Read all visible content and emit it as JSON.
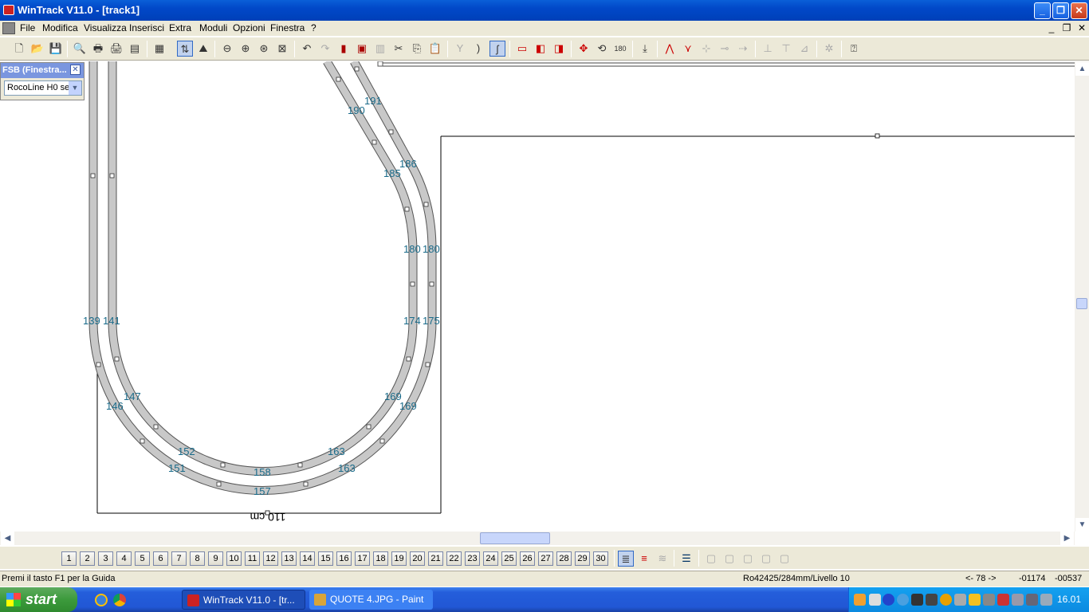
{
  "window": {
    "title": "WinTrack  V11.0 - [track1]"
  },
  "menu": [
    "File",
    "Modifica",
    "Visualizza",
    "Inserisci",
    "Extra",
    "Moduli",
    "Opzioni",
    "Finestra",
    "?"
  ],
  "fsb": {
    "title": "FSB (Finestra...",
    "selected": "RocoLine H0 se"
  },
  "track_labels": [
    "191",
    "190",
    "186",
    "185",
    "180",
    "180",
    "139",
    "141",
    "174",
    "175",
    "147",
    "146",
    "169",
    "169",
    "152",
    "151",
    "163",
    "163",
    "158",
    "157"
  ],
  "dimension_label": "110 cm",
  "layers": [
    "1",
    "2",
    "3",
    "4",
    "5",
    "6",
    "7",
    "8",
    "9",
    "10",
    "11",
    "12",
    "13",
    "14",
    "15",
    "16",
    "17",
    "18",
    "19",
    "20",
    "21",
    "22",
    "23",
    "24",
    "25",
    "26",
    "27",
    "28",
    "29",
    "30"
  ],
  "status": {
    "help": "Premi il tasto F1 per la Guida",
    "info": "Ro42425/284mm/Livello 10",
    "nav": "<- 78 ->",
    "x": "-01174",
    "y": "-00537"
  },
  "taskbar": {
    "start": "start",
    "tasks": [
      "WinTrack  V11.0 - [tr...",
      "QUOTE 4.JPG - Paint"
    ],
    "clock": "16.01"
  },
  "icons": {
    "minimize": "_",
    "restore": "❐",
    "close": "✕",
    "scroll_up": "▲",
    "scroll_down": "▼",
    "scroll_left": "◀",
    "scroll_right": "▶"
  }
}
